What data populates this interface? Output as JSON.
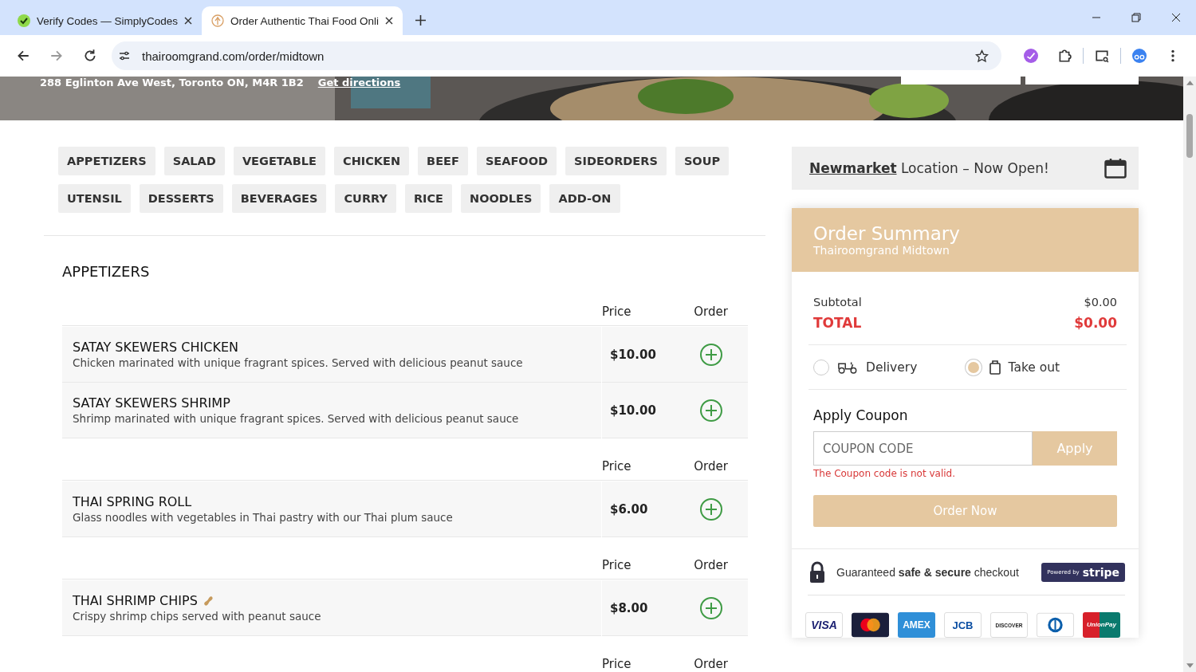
{
  "browser": {
    "tabs": [
      {
        "title": "Verify Codes — SimplyCodes",
        "selected": false
      },
      {
        "title": "Order Authentic Thai Food Onli",
        "selected": true
      }
    ],
    "url": "thairoomgrand.com/order/midtown"
  },
  "hero": {
    "kind": "picture",
    "address": "288 Eglinton Ave West, Toronto ON, M4R 1B2",
    "link": "Get directions"
  },
  "categories": [
    {
      "label": "APPETIZERS"
    },
    {
      "label": "SALAD"
    },
    {
      "label": "VEGETABLE"
    },
    {
      "label": "CHICKEN"
    },
    {
      "label": "BEEF"
    },
    {
      "label": "SEAFOOD"
    },
    {
      "label": "SIDEORDERS"
    },
    {
      "label": "SOUP"
    },
    {
      "label": "UTENSIL"
    },
    {
      "label": "DESSERTS"
    },
    {
      "label": "BEVERAGES"
    },
    {
      "label": "CURRY"
    },
    {
      "label": "RICE"
    },
    {
      "label": "NOODLES"
    },
    {
      "label": "ADD-ON"
    }
  ],
  "menu": {
    "title": "APPETIZERS",
    "groups": [
      {
        "price_heading": "Price",
        "order_heading": "Order",
        "items": [
          {
            "name": "SATAY SKEWERS CHICKEN",
            "description": "Chicken marinated with unique fragrant spices. Served with delicious peanut sauce",
            "price": "$10.00",
            "peanut": false
          },
          {
            "name": "SATAY SKEWERS SHRIMP",
            "description": "Shrimp marinated with unique fragrant spices. Served with delicious peanut sauce",
            "price": "$10.00",
            "peanut": false
          }
        ]
      },
      {
        "price_heading": "Price",
        "order_heading": "Order",
        "items": [
          {
            "name": "THAI SPRING ROLL",
            "description": "Glass noodles with vegetables in Thai pastry with our Thai plum sauce",
            "price": "$6.00",
            "peanut": false
          }
        ]
      },
      {
        "price_heading": "Price",
        "order_heading": "Order",
        "items": [
          {
            "name": "THAI SHRIMP CHIPS",
            "description": "Crispy shrimp chips served with peanut sauce",
            "price": "$8.00",
            "peanut": true
          }
        ]
      },
      {
        "price_heading": "Price",
        "order_heading": "Order"
      }
    ]
  },
  "announcement": {
    "link": "Newmarket",
    "text": "Location – Now Open!"
  },
  "order_summary": {
    "title": "Order Summary",
    "subtitle": "Thairoomgrand Midtown",
    "subtotal_label": "Subtotal",
    "subtotal": "$0.00",
    "total_label": "TOTAL",
    "total": "$0.00",
    "methods": [
      {
        "kind": "delivery",
        "label": "Delivery",
        "selected": false
      },
      {
        "kind": "takeout",
        "label": "Take out",
        "selected": true
      }
    ],
    "coupon_heading": "Apply Coupon",
    "coupon_placeholder": "COUPON CODE",
    "apply": "Apply",
    "error": "The Coupon code is not valid.",
    "order_button": "Order Now",
    "secure": "Guaranteed **safe & secure** checkout",
    "stripe_small": "Powered by",
    "stripe": "stripe",
    "cards": [
      {
        "kind": "visa",
        "label": "VISA"
      },
      {
        "kind": "mastercard"
      },
      {
        "kind": "amex",
        "label": "AMEX"
      },
      {
        "kind": "jcb",
        "label": "JCB"
      },
      {
        "kind": "discover",
        "label": "DISCOVER"
      },
      {
        "kind": "diners"
      },
      {
        "kind": "unionpay",
        "label": "UnionPay"
      }
    ]
  }
}
